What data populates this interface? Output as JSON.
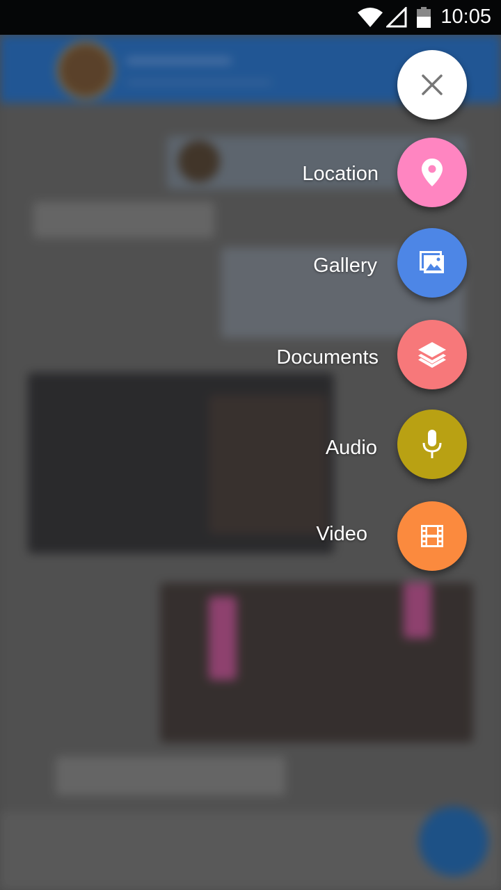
{
  "status_bar": {
    "time": "10:05",
    "icons": [
      "wifi-icon",
      "cell-signal-icon",
      "battery-icon"
    ]
  },
  "background_chat": {
    "blurred": true
  },
  "speed_dial": {
    "close_icon": "close-icon",
    "items": [
      {
        "label": "Location",
        "icon": "location-pin-icon",
        "color": "#ff85c1"
      },
      {
        "label": "Gallery",
        "icon": "image-icon",
        "color": "#4d86e6"
      },
      {
        "label": "Documents",
        "icon": "layers-icon",
        "color": "#f7787a"
      },
      {
        "label": "Audio",
        "icon": "microphone-icon",
        "color": "#b9a113"
      },
      {
        "label": "Video",
        "icon": "film-icon",
        "color": "#fb8a3e"
      }
    ]
  }
}
